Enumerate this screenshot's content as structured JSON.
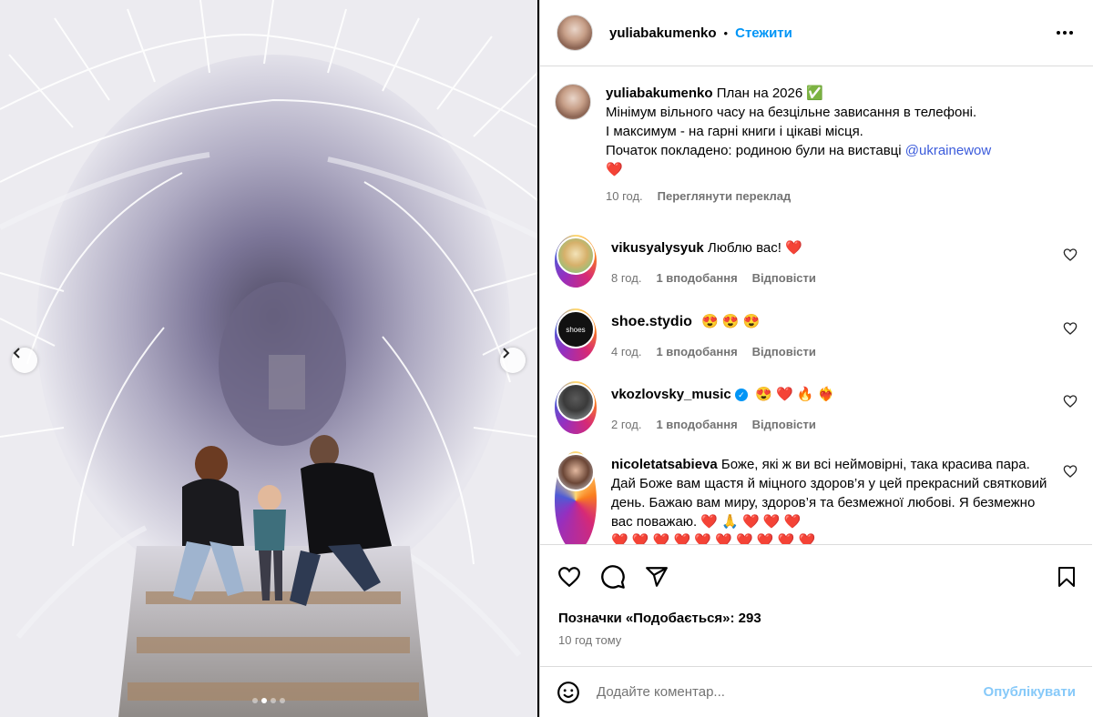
{
  "post": {
    "username": "yuliabakumenko",
    "follow_label": "Стежити",
    "separator": "•",
    "caption_title": "План на 2026",
    "caption_title_emoji": "✅",
    "caption_lines": [
      "Мінімум вільного часу на безцільне зависання в телефоні.",
      "І максимум - на гарні книги і цікаві місця.",
      "Початок покладено: родиною були на виставці"
    ],
    "caption_mention": "@ukrainewow",
    "caption_end_emoji": "❤️",
    "caption_time": "10 год.",
    "translate_label": "Переглянути переклад"
  },
  "comments": [
    {
      "username": "vikusyalysyuk",
      "text": "Люблю вас!",
      "emoji": "❤️",
      "time": "8 год.",
      "likes": "1 вподобання",
      "reply": "Відповісти"
    },
    {
      "username": "shoe.stydio",
      "text": "",
      "emoji": "😍 😍 😍",
      "time": "4 год.",
      "likes": "1 вподобання",
      "reply": "Відповісти",
      "avatar_text": "shoes"
    },
    {
      "username": "vkozlovsky_music",
      "text": "",
      "emoji": "😍 ❤️ 🔥 ❤️‍🔥",
      "time": "2 год.",
      "likes": "1 вподобання",
      "reply": "Відповісти"
    },
    {
      "username": "nicoletatsabieva",
      "text": "Боже, які ж ви всі неймовірні, така красива пара. Дай Боже вам щастя й міцного здоров’я у цей прекрасний святковий день. Бажаю вам миру, здоров’я та безмежної любові. Я безмежно вас поважаю.",
      "emoji": "❤️ 🙏 ❤️ ❤️ ❤️",
      "emoji_row2": "❤️ ❤️ ❤️ ❤️ ❤️ ❤️ ❤️ ❤️ ❤️ ❤️"
    }
  ],
  "footer": {
    "likes_label": "Позначки «Подобається»: 293",
    "posted": "10 год тому",
    "comment_placeholder": "Додайте коментар...",
    "publish_label": "Опублікувати"
  },
  "carousel": {
    "slides": 4,
    "active_index": 1
  },
  "colors": {
    "accent": "#0095f6",
    "mention": "#3b5bdb",
    "muted": "#737373",
    "border": "#dbdbdb",
    "like_red": "#ed4956"
  }
}
